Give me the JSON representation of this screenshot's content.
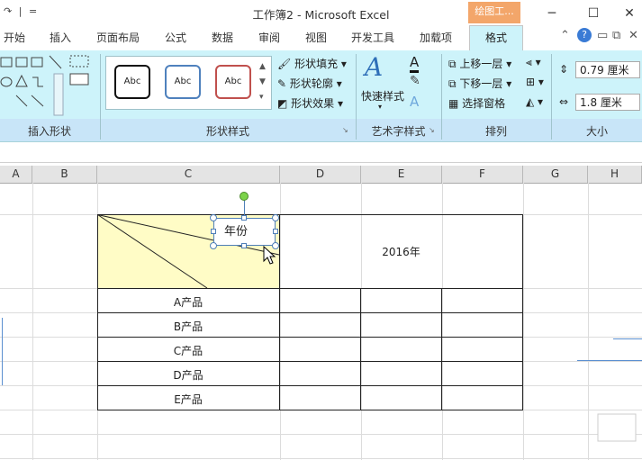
{
  "window": {
    "title": "工作簿2 - Microsoft Excel",
    "context_tab": "绘图工...",
    "qat_redo": "↷",
    "qat_sep": "|",
    "qat_menu": "="
  },
  "tabs": [
    {
      "label": "开始"
    },
    {
      "label": "插入"
    },
    {
      "label": "页面布局"
    },
    {
      "label": "公式"
    },
    {
      "label": "数据"
    },
    {
      "label": "审阅"
    },
    {
      "label": "视图"
    },
    {
      "label": "开发工具"
    },
    {
      "label": "加载项"
    },
    {
      "label": "格式"
    }
  ],
  "ribbon": {
    "groups": {
      "insert_shapes": "插入形状",
      "shape_styles": "形状样式",
      "wordart_styles": "艺术字样式",
      "arrange": "排列",
      "size": "大小"
    },
    "style_samples": [
      "Abc",
      "Abc",
      "Abc"
    ],
    "shape_fill": "形状填充",
    "shape_outline": "形状轮廓",
    "shape_effects": "形状效果",
    "quick_styles": "快速样式",
    "bring_forward": "上移一层",
    "send_backward": "下移一层",
    "selection_pane": "选择窗格",
    "height_value": "0.79 厘米",
    "width_value": "1.8 厘米"
  },
  "colors": {
    "ribbon_bg": "#cdf3fa",
    "group_bar": "#c8e5f8",
    "context_tab": "#f3a66a",
    "header_cell": "#fffcc6",
    "border_red": "#c0504d",
    "border_blue": "#4f81bd"
  },
  "sheet": {
    "columns": [
      "A",
      "B",
      "C",
      "D",
      "E",
      "F",
      "G",
      "H"
    ],
    "textbox": "年份",
    "year_header": "2016年",
    "products": [
      "A产品",
      "B产品",
      "C产品",
      "D产品",
      "E产品"
    ]
  }
}
